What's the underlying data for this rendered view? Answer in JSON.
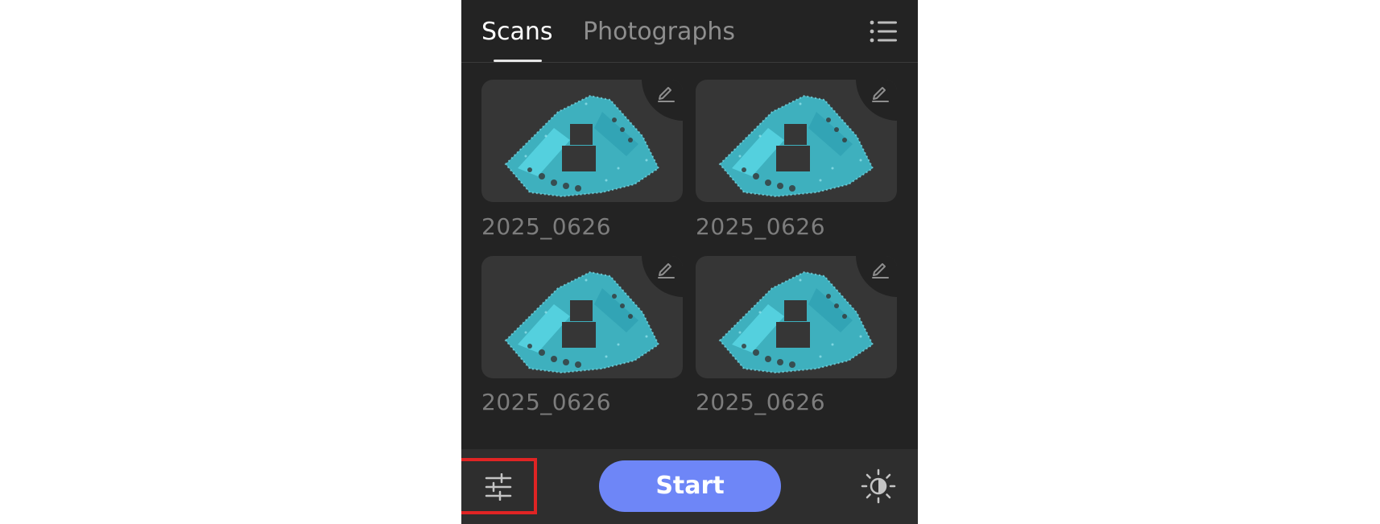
{
  "tabs": {
    "scans_label": "Scans",
    "photographs_label": "Photographs",
    "active": "Scans"
  },
  "icons": {
    "list": "list-view-icon",
    "edit": "pencil-edit-icon",
    "settings": "sliders-settings-icon",
    "brightness": "brightness-contrast-icon"
  },
  "scans": [
    {
      "name": "2025_0626"
    },
    {
      "name": "2025_0626"
    },
    {
      "name": "2025_0626"
    },
    {
      "name": "2025_0626"
    }
  ],
  "bottom_bar": {
    "start_label": "Start"
  },
  "colors": {
    "background": "#232323",
    "card": "#363636",
    "accent": "#6e86f7",
    "point_cloud": "#3fc6d6",
    "highlight_box": "#e02424"
  }
}
